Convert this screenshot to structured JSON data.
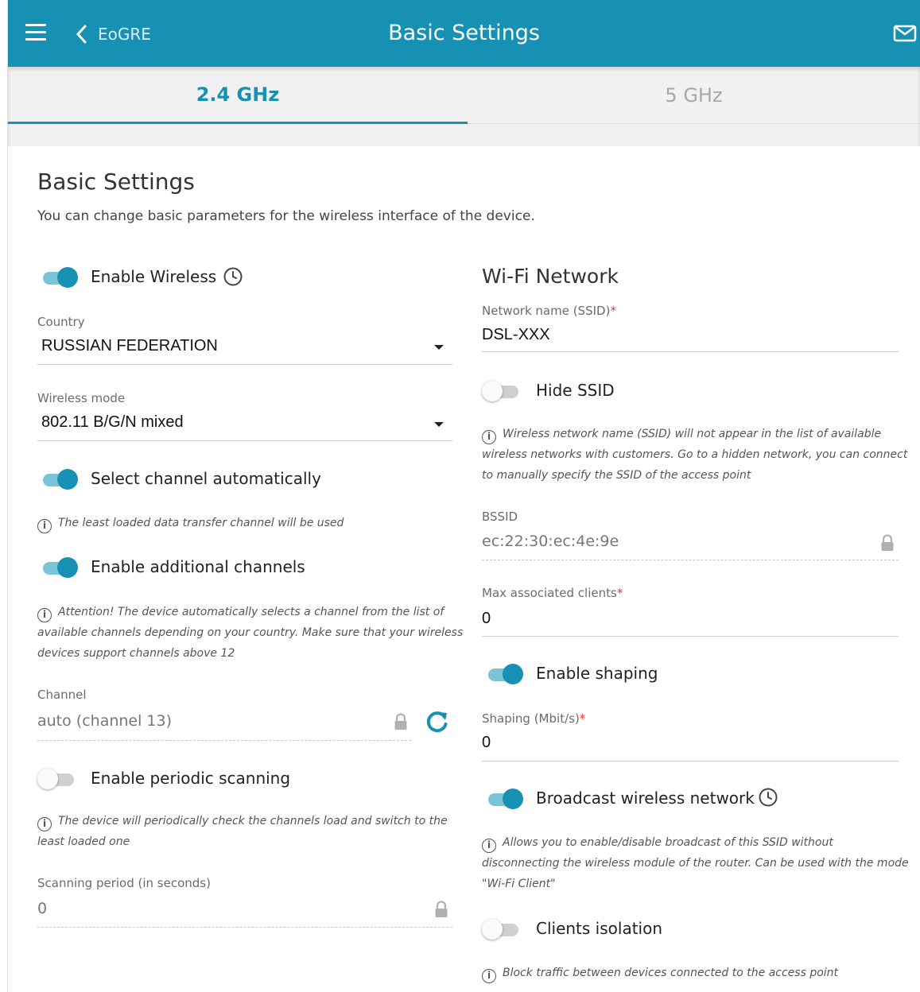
{
  "header": {
    "back_label": "EoGRE",
    "title": "Basic Settings"
  },
  "tabs": [
    {
      "label": "2.4 GHz",
      "active": true
    },
    {
      "label": "5 GHz",
      "active": false
    }
  ],
  "section": {
    "title": "Basic Settings",
    "description": "You can change basic parameters for the wireless interface of the device."
  },
  "left": {
    "enable_wireless": {
      "label": "Enable Wireless",
      "on": true
    },
    "country": {
      "label": "Country",
      "value": "RUSSIAN FEDERATION"
    },
    "wireless_mode": {
      "label": "Wireless mode",
      "value": "802.11 B/G/N mixed"
    },
    "select_channel_auto": {
      "label": "Select channel automatically",
      "on": true,
      "hint": "The least loaded data transfer channel will be used"
    },
    "additional_channels": {
      "label": "Enable additional channels",
      "on": true,
      "hint_lines": [
        "Attention! The device automatically selects a channel from the list of",
        "available channels depending on your country. Make sure that your wireless",
        "devices support channels above 12"
      ]
    },
    "channel": {
      "label": "Channel",
      "value": "auto (channel 13)"
    },
    "periodic_scanning": {
      "label": "Enable periodic scanning",
      "on": false,
      "hint_lines": [
        "The device will periodically check the channels load and switch to the",
        "least loaded one"
      ]
    },
    "scanning_period": {
      "label": "Scanning period (in seconds)",
      "value": "0"
    }
  },
  "right": {
    "title": "Wi-Fi Network",
    "ssid": {
      "label": "Network name (SSID)",
      "required": "*",
      "value": "DSL-XXX"
    },
    "hide_ssid": {
      "label": "Hide SSID",
      "on": false,
      "hint_lines": [
        "Wireless network name (SSID) will not appear in the list of available",
        "wireless networks with customers. Go to a hidden network, you can connect",
        "to manually specify the SSID of the access point"
      ]
    },
    "bssid": {
      "label": "BSSID",
      "value": "ec:22:30:ec:4e:9e"
    },
    "max_clients": {
      "label": "Max associated clients",
      "required": "*",
      "value": "0"
    },
    "enable_shaping": {
      "label": "Enable shaping",
      "on": true
    },
    "shaping": {
      "label": "Shaping (Mbit/s)",
      "required": "*",
      "value": "0"
    },
    "broadcast": {
      "label": "Broadcast wireless network",
      "on": true,
      "hint_lines": [
        "Allows you to enable/disable broadcast of this SSID without",
        "disconnecting the wireless module of the router. Can be used with the mode",
        "\"Wi-Fi Client\""
      ]
    },
    "clients_isolation": {
      "label": "Clients isolation",
      "on": false,
      "hint": "Block traffic between devices connected to the access point"
    }
  },
  "colors": {
    "accent": "#1791b3",
    "toggle_track_on": "#7bc3d9",
    "required": "#e53935"
  },
  "icons": [
    "menu-icon",
    "chevron-left-icon",
    "mail-icon",
    "clock-icon",
    "caret-down-icon",
    "info-icon",
    "lock-icon",
    "refresh-icon"
  ]
}
